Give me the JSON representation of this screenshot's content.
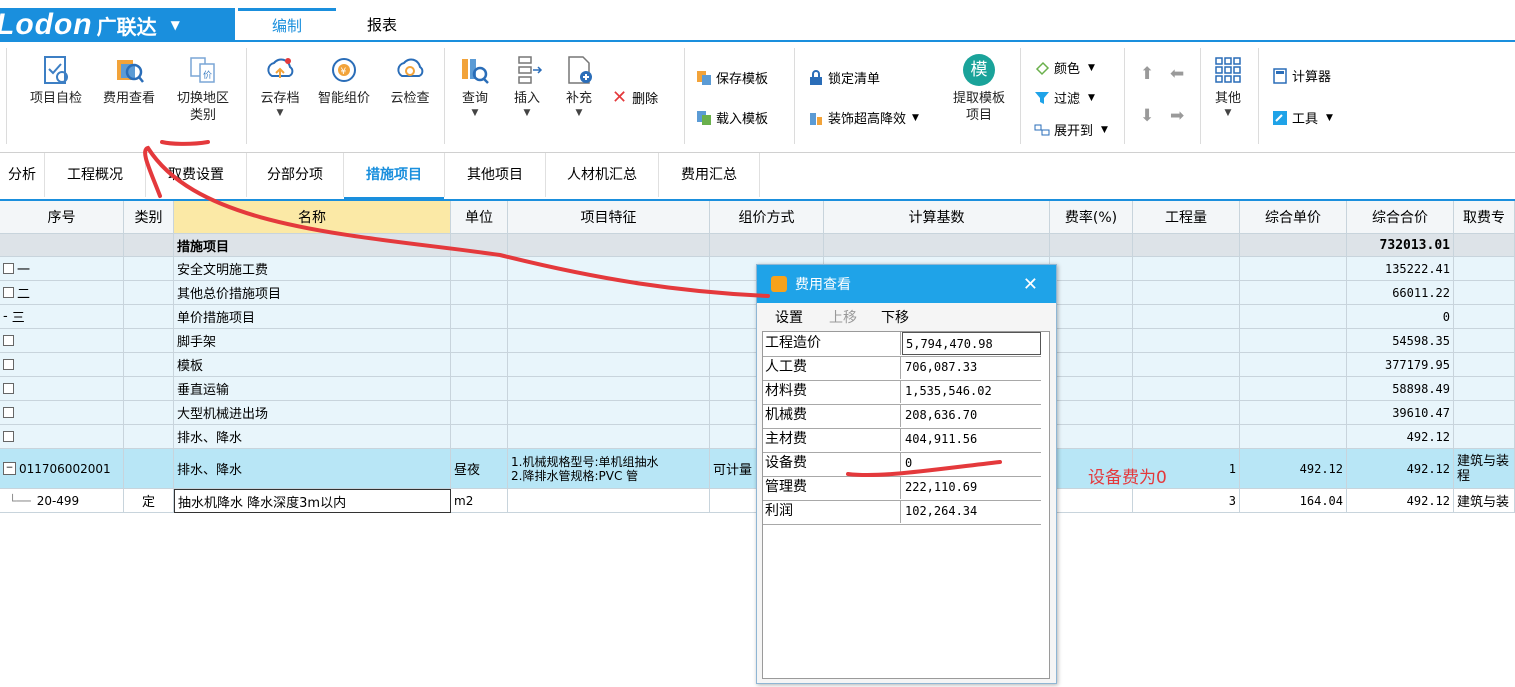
{
  "header": {
    "logo_text": "Lodon",
    "logo_cn": "广联达",
    "logo_caret": "▼",
    "tabs": [
      {
        "label": "编制"
      },
      {
        "label": "报表"
      }
    ]
  },
  "ribbon": {
    "buttons": [
      {
        "label": "项目自检"
      },
      {
        "label": "费用查看"
      },
      {
        "label": "切换地区",
        "label2": "类别"
      },
      {
        "label": "云存档"
      },
      {
        "label": "智能组价"
      },
      {
        "label": "云检查"
      },
      {
        "label": "查询"
      },
      {
        "label": "插入"
      },
      {
        "label": "补充"
      },
      {
        "label": "删除"
      },
      {
        "label": "保存模板"
      },
      {
        "label": "载入模板"
      },
      {
        "label": "锁定清单"
      },
      {
        "label": "装饰超高降效"
      },
      {
        "label": "提取模板",
        "label2": "项目"
      },
      {
        "label": "颜色"
      },
      {
        "label": "过滤"
      },
      {
        "label": "展开到"
      },
      {
        "label": "其他"
      },
      {
        "label": "计算器"
      },
      {
        "label": "工具"
      }
    ],
    "template_badge": "模"
  },
  "section_tabs": [
    "分析",
    "工程概况",
    "取费设置",
    "分部分项",
    "措施项目",
    "其他项目",
    "人材机汇总",
    "费用汇总"
  ],
  "grid": {
    "columns": [
      "序号",
      "类别",
      "名称",
      "单位",
      "项目特征",
      "组价方式",
      "计算基数",
      "费率(%)",
      "工程量",
      "综合单价",
      "综合合价",
      "取费专"
    ],
    "rows": [
      {
        "seq": "",
        "cat": "",
        "name": "措施项目",
        "unit": "",
        "feat": "",
        "method": "",
        "qty": "",
        "price": "",
        "total": "732013.01",
        "fee": ""
      },
      {
        "seq": "一",
        "cat": "",
        "name": "安全文明施工费",
        "unit": "",
        "feat": "",
        "method": "",
        "qty": "",
        "price": "",
        "total": "135222.41",
        "fee": ""
      },
      {
        "seq": "二",
        "cat": "",
        "name": "其他总价措施项目",
        "unit": "",
        "feat": "",
        "method": "",
        "qty": "",
        "price": "",
        "total": "66011.22",
        "fee": ""
      },
      {
        "seq": "三",
        "cat": "",
        "name": "单价措施项目",
        "unit": "",
        "feat": "",
        "method": "",
        "qty": "",
        "price": "",
        "total": "0",
        "fee": ""
      },
      {
        "seq": "",
        "cat": "",
        "name": "脚手架",
        "unit": "",
        "feat": "",
        "method": "",
        "qty": "",
        "price": "",
        "total": "54598.35",
        "fee": ""
      },
      {
        "seq": "",
        "cat": "",
        "name": "模板",
        "unit": "",
        "feat": "",
        "method": "",
        "qty": "",
        "price": "",
        "total": "377179.95",
        "fee": ""
      },
      {
        "seq": "",
        "cat": "",
        "name": "垂直运输",
        "unit": "",
        "feat": "",
        "method": "",
        "qty": "",
        "price": "",
        "total": "58898.49",
        "fee": ""
      },
      {
        "seq": "",
        "cat": "",
        "name": "大型机械进出场",
        "unit": "",
        "feat": "",
        "method": "",
        "qty": "",
        "price": "",
        "total": "39610.47",
        "fee": ""
      },
      {
        "seq": "",
        "cat": "",
        "name": "排水、降水",
        "unit": "",
        "feat": "",
        "method": "",
        "qty": "",
        "price": "",
        "total": "492.12",
        "fee": ""
      },
      {
        "seq": "011706002001",
        "cat": "",
        "name": "排水、降水",
        "unit": "昼夜",
        "feat": "1.机械规格型号:单机组抽水",
        "feat2": "2.降排水管规格:PVC 管",
        "method": "可计量",
        "qty": "1",
        "price": "492.12",
        "total": "492.12",
        "fee": "建筑与装",
        "fee2": "程"
      },
      {
        "seq": "20-499",
        "cat": "定",
        "name": "抽水机降水 降水深度3m以内",
        "unit": "m2",
        "feat": "",
        "method": "",
        "qty": "3",
        "price": "164.04",
        "total": "492.12",
        "fee": "建筑与装"
      }
    ]
  },
  "popup": {
    "title": "费用查看",
    "close": "✕",
    "menu": [
      "设置",
      "上移",
      "下移"
    ],
    "rows": [
      {
        "label": "工程造价",
        "value": "5,794,470.98"
      },
      {
        "label": "人工费",
        "value": "706,087.33"
      },
      {
        "label": "材料费",
        "value": "1,535,546.02"
      },
      {
        "label": "机械费",
        "value": "208,636.70"
      },
      {
        "label": "主材费",
        "value": "404,911.56"
      },
      {
        "label": "设备费",
        "value": "0"
      },
      {
        "label": "管理费",
        "value": "222,110.69"
      },
      {
        "label": "利润",
        "value": "102,264.34"
      }
    ]
  },
  "annotation": "设备费为0",
  "colors": {
    "brand": "#1a8fdd",
    "popup_title": "#1fa3e8",
    "annotation_red": "#e4393c"
  }
}
